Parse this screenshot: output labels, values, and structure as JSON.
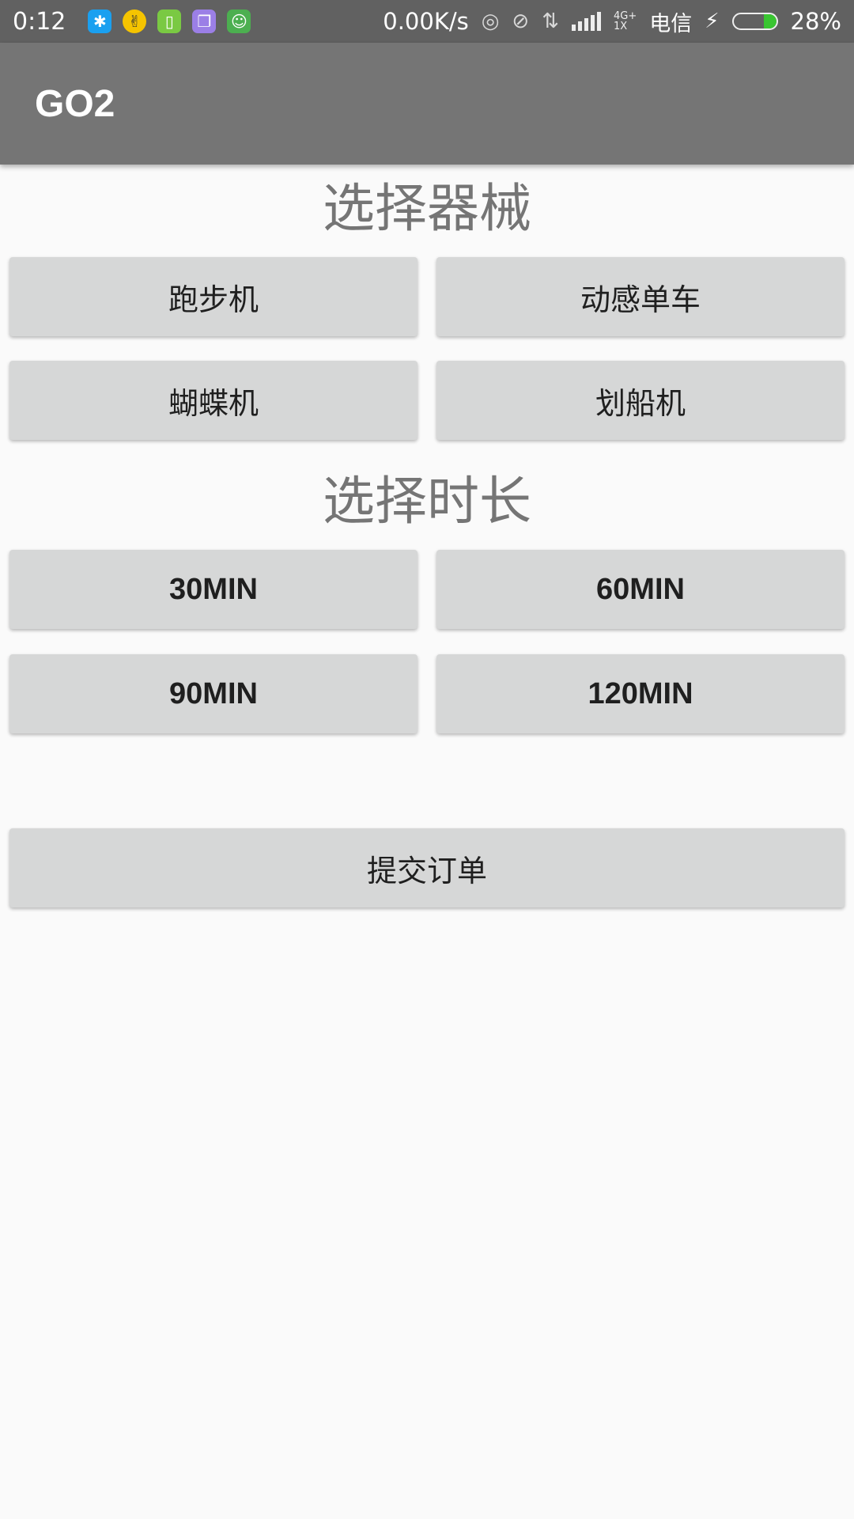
{
  "status_bar": {
    "time": "0:12",
    "notification_icons": [
      {
        "name": "qq-icon",
        "glyph": "✱",
        "color": "#1aa0f0"
      },
      {
        "name": "hand-icon",
        "glyph": "✌",
        "color": "#f5c400"
      },
      {
        "name": "phone-icon",
        "glyph": "▯",
        "color": "#7ac943"
      },
      {
        "name": "files-icon",
        "glyph": "❐",
        "color": "#9b7fe6"
      },
      {
        "name": "android-icon",
        "glyph": "☺",
        "color": "#4caf50"
      }
    ],
    "net_speed": "0.00K/s",
    "net_type_top": "4G+",
    "net_type_bottom": "1X",
    "carrier": "电信",
    "battery_percent": "28%",
    "battery_level": 0.28,
    "battery_color": "#39c531"
  },
  "app_bar": {
    "title": "GO2",
    "color": "#757575"
  },
  "equipment": {
    "title": "选择器械",
    "options": [
      "跑步机",
      "动感单车",
      "蝴蝶机",
      "划船机"
    ]
  },
  "duration": {
    "title": "选择时长",
    "options": [
      "30MIN",
      "60MIN",
      "90MIN",
      "120MIN"
    ]
  },
  "submit": {
    "label": "提交订单"
  }
}
